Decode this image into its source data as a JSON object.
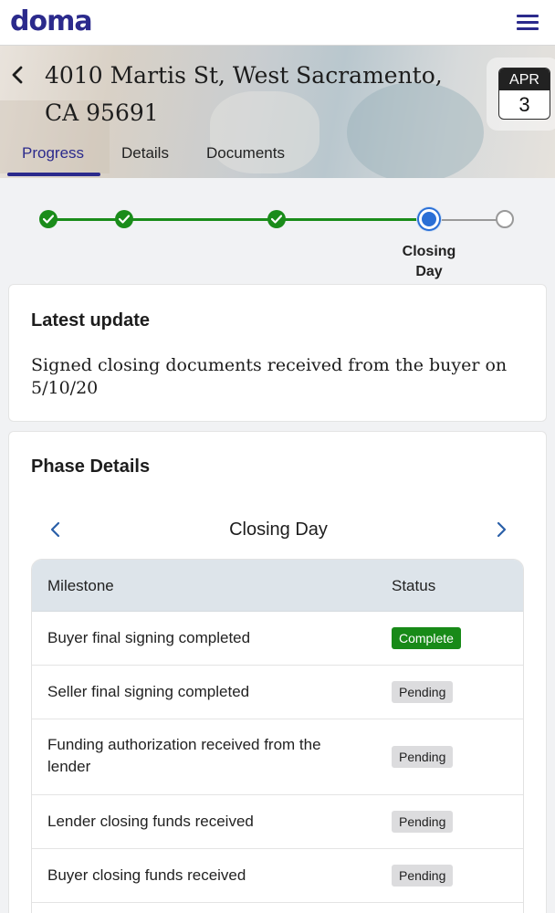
{
  "app": {
    "logo": "doma"
  },
  "header": {
    "address": "4010 Martis St, West Sacramento, CA 95691",
    "date": {
      "month": "APR",
      "day": "3"
    }
  },
  "tabs": [
    {
      "label": "Progress",
      "active": true
    },
    {
      "label": "Details",
      "active": false
    },
    {
      "label": "Documents",
      "active": false
    }
  ],
  "progress": {
    "steps_completed": 3,
    "steps_total": 5,
    "current_step_index": 3,
    "current_label": "Closing Day"
  },
  "latest_update": {
    "title": "Latest update",
    "text": "Signed closing documents received from the buyer on 5/10/20"
  },
  "phase_details": {
    "title": "Phase Details",
    "phase_name": "Closing Day",
    "columns": {
      "milestone": "Milestone",
      "status": "Status"
    },
    "rows": [
      {
        "milestone": "Buyer final signing completed",
        "status": "Complete"
      },
      {
        "milestone": "Seller final signing completed",
        "status": "Pending"
      },
      {
        "milestone": "Funding authorization received from the lender",
        "status": "Pending"
      },
      {
        "milestone": "Lender closing funds received",
        "status": "Pending"
      },
      {
        "milestone": "Buyer closing funds received",
        "status": "Pending"
      }
    ]
  },
  "colors": {
    "brand": "#2b2a8c",
    "complete": "#188a18",
    "current": "#2a6fd6",
    "pending_badge": "#dcdcde"
  },
  "icons": {
    "menu": "hamburger-icon",
    "back": "chevron-left-icon",
    "prev": "chevron-left-icon",
    "next": "chevron-right-icon",
    "check": "check-icon"
  }
}
